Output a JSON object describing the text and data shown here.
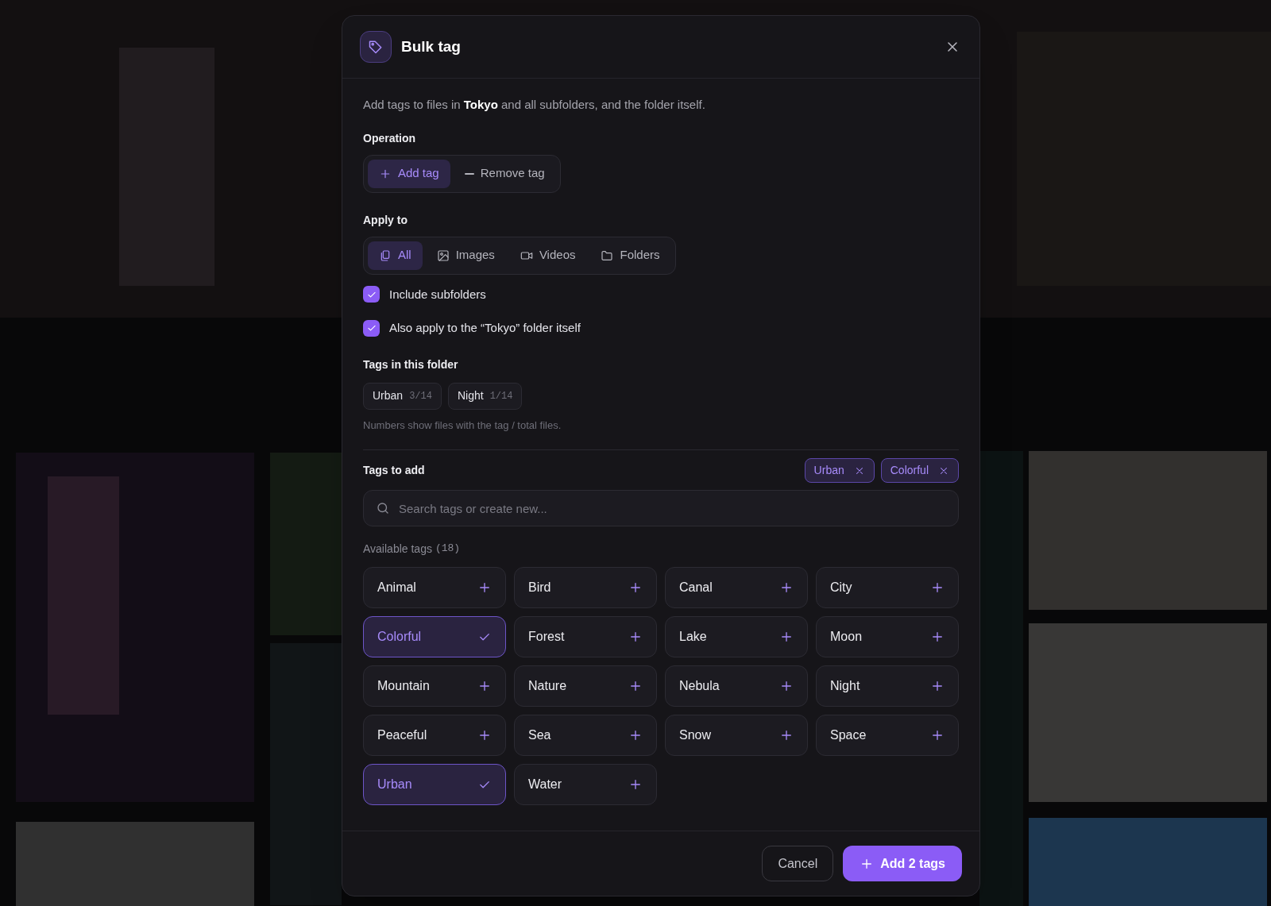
{
  "dialog": {
    "title": "Bulk tag",
    "description": "Add tags to files in **Tokyo** and all subfolders, and the folder itself.",
    "operation": {
      "label": "Operation",
      "options": [
        {
          "label": "Add tag",
          "kind": "add",
          "selected": true
        },
        {
          "label": "Remove tag",
          "kind": "remove",
          "selected": false
        }
      ]
    },
    "apply_to": {
      "label": "Apply to",
      "options": [
        {
          "label": "All",
          "kind": "all",
          "selected": true
        },
        {
          "label": "Images",
          "kind": "images",
          "selected": false
        },
        {
          "label": "Videos",
          "kind": "videos",
          "selected": false
        },
        {
          "label": "Folders",
          "kind": "folders",
          "selected": false
        }
      ]
    },
    "checkboxes": [
      {
        "label": "Include subfolders",
        "checked": true
      },
      {
        "label": "Also apply to the “Tokyo” folder itself",
        "checked": true
      }
    ],
    "folder_tags": {
      "label": "Tags in this folder",
      "tags": [
        {
          "name": "Urban",
          "count": "3/14"
        },
        {
          "name": "Night",
          "count": "1/14"
        }
      ],
      "note": "Numbers show files with the tag / total files."
    },
    "tags_to_add": {
      "label": "Tags to add",
      "chosen": [
        "Urban",
        "Colorful"
      ]
    },
    "search": {
      "placeholder": "Search tags or create new..."
    },
    "available": {
      "label": "Available tags",
      "count": "(18)",
      "tags": [
        {
          "name": "Animal",
          "selected": false
        },
        {
          "name": "Bird",
          "selected": false
        },
        {
          "name": "Canal",
          "selected": false
        },
        {
          "name": "City",
          "selected": false
        },
        {
          "name": "Colorful",
          "selected": true
        },
        {
          "name": "Forest",
          "selected": false
        },
        {
          "name": "Lake",
          "selected": false
        },
        {
          "name": "Moon",
          "selected": false
        },
        {
          "name": "Mountain",
          "selected": false
        },
        {
          "name": "Nature",
          "selected": false
        },
        {
          "name": "Nebula",
          "selected": false
        },
        {
          "name": "Night",
          "selected": false
        },
        {
          "name": "Peaceful",
          "selected": false
        },
        {
          "name": "Sea",
          "selected": false
        },
        {
          "name": "Snow",
          "selected": false
        },
        {
          "name": "Space",
          "selected": false
        },
        {
          "name": "Urban",
          "selected": true
        },
        {
          "name": "Water",
          "selected": false
        }
      ]
    },
    "buttons": {
      "cancel": "Cancel",
      "confirm": "Add 2 tags"
    }
  }
}
